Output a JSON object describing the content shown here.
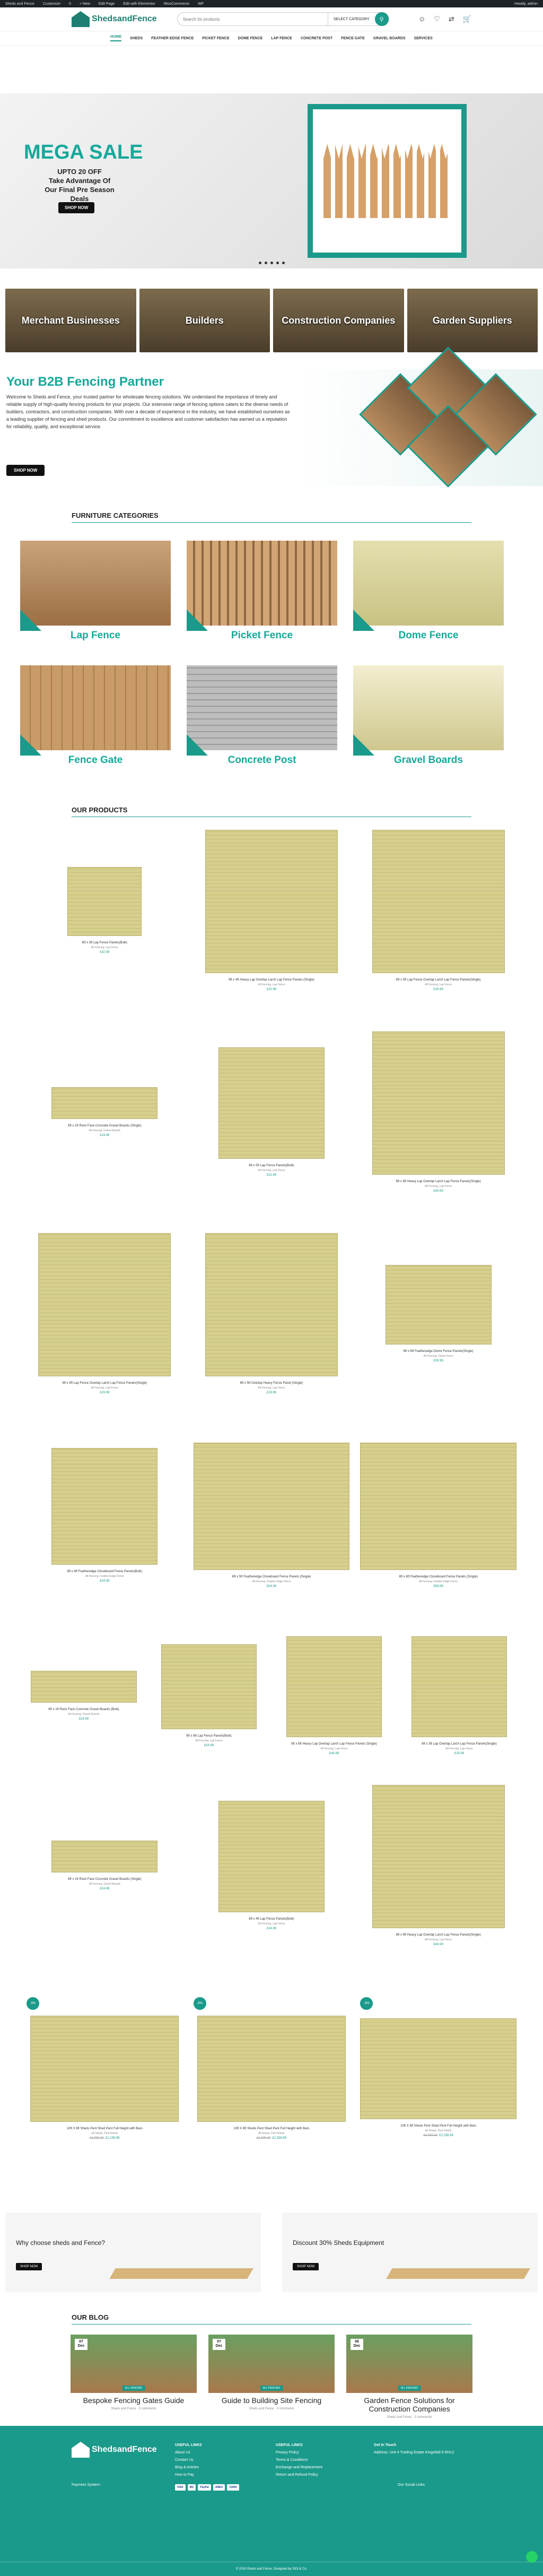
{
  "admin_bar": {
    "site": "Sheds and Fence",
    "customize": "Customize",
    "comments": "0",
    "new": "+ New",
    "edit_page": "Edit Page",
    "edit_with": "Edit with Elementor",
    "woo": "WooCommerce",
    "wp": "WP",
    "user": "Howdy, admin"
  },
  "header": {
    "logo_text": "ShedsandFence",
    "search_placeholder": "Search for products",
    "search_category": "SELECT CATEGORY"
  },
  "nav": [
    "HOME",
    "SHEDS",
    "FEATHER EDGE FENCE",
    "PICKET FENCE",
    "DOME FENCE",
    "LAP FENCE",
    "CONCRETE POST",
    "FENCE GATE",
    "GRAVEL BOARDS",
    "SERVICES"
  ],
  "hero": {
    "title": "MEGA SALE",
    "subtitle": "UPTO 20 OFF\nTake Advantage Of Our Final Pre Season Deals",
    "cta": "SHOP NOW"
  },
  "tiles": [
    "Merchant Businesses",
    "Builders",
    "Construction Companies",
    "Garden Suppliers"
  ],
  "b2b": {
    "title": "Your B2B Fencing Partner",
    "text": "Welcome to Sheds and Fence, your trusted partner for wholesale fencing solutions. We understand the importance of timely and reliable supply of high-quality fencing products for your projects. Our extensive range of fencing options caters to the diverse needs of builders, contractors, and construction companies. With over a decade of experience in the industry, we have established ourselves as a leading supplier of fencing and shed products. Our commitment to excellence and customer satisfaction has earned us a reputation for reliability, quality, and exceptional service.",
    "cta": "SHOP NOW"
  },
  "categories_title": "FURNITURE CATEGORIES",
  "categories": [
    "Lap Fence",
    "Picket Fence",
    "Dome Fence",
    "Fence Gate",
    "Concrete Post",
    "Gravel Boards"
  ],
  "products_title": "OUR PRODUCTS",
  "products": [
    {
      "name": "6ft x 3ft Lap Fence Panels(Bulk)",
      "cat": "All Fencing, Lap Fence",
      "price": "£32.99"
    },
    {
      "name": "6ft x 4ft Heavy Lap Overlap Larch Lap Fence Panels (Single)",
      "cat": "All Fencing, Lap Fence",
      "price": "£32.99"
    },
    {
      "name": "6ft x 5ft Lap Fence Overlap Larch Lap Fence Panels(Single)",
      "cat": "All Fencing, Lap Fence",
      "price": "£29.99"
    },
    {
      "name": "6ft x 1ft Rock Face Concrete Gravel Boards (Single)",
      "cat": "All Fencing, Gravel Boards",
      "price": "£24.99"
    },
    {
      "name": "6ft x 5ft Lap Fence Panels(Bulk)",
      "cat": "All Fencing, Lap Fence",
      "price": "£32.99"
    },
    {
      "name": "6ft x 6ft Heavy Lap Overlap Larch Lap Fence Panels(Single)",
      "cat": "All Fencing, Lap Fence",
      "price": "£44.99"
    },
    {
      "name": "6ft x 5ft Lap Fence Overlap Larch Lap Fence Panels(Single)",
      "cat": "All Fencing, Lap Fence",
      "price": "£29.99"
    },
    {
      "name": "6ft x 5ft Overlap Heavy Fence Panel (Single)",
      "cat": "All Fencing, Lap Fence",
      "price": "£29.99"
    },
    {
      "name": "6ft x 6ft Featheredge Dome Fence Panels(Single)",
      "cat": "All Fencing, Dome Fence",
      "price": "£39.99"
    },
    {
      "name": "6ft x 6ft Featheredge Closeboard Fence Panels(Bulk)",
      "cat": "All Fencing, Feather Edge Fence",
      "price": "£54.99"
    },
    {
      "name": "6ft x 5ft Featheredge Closeboard Fence Panels (Single)",
      "cat": "All Fencing, Feather Edge Fence",
      "price": "£54.99"
    },
    {
      "name": "6ft x 6ft Featheredge Closeboard Fence Panels (Single)",
      "cat": "All Fencing, Feather Edge Fence",
      "price": "£59.99"
    },
    {
      "name": "6ft x 1ft Rock Face Concrete Gravel Boards (Bulk)",
      "cat": "All Fencing, Gravel Boards",
      "price": "£24.99"
    },
    {
      "name": "6ft x 6ft Lap Fence Panels(Bulk)",
      "cat": "All Fencing, Lap Fence",
      "price": "£34.99"
    },
    {
      "name": "6ft x 6ft Heavy Lap Overlap Larch Lap Fence Panels (Single)",
      "cat": "All Fencing, Lap Fence",
      "price": "£44.99"
    },
    {
      "name": "6ft x 3ft Lap Overlap Larch Lap Fence Panels(Single)",
      "cat": "All Fencing, Lap Fence",
      "price": "£29.99"
    },
    {
      "name": "6ft x 1ft Rock Face Concrete Gravel Boards (Single)",
      "cat": "All Fencing, Gravel Boards",
      "price": "£24.99"
    },
    {
      "name": "6ft x 4ft Lap Fence Panels(Bulk)",
      "cat": "All Fencing, Lap Fence",
      "price": "£34.99"
    },
    {
      "name": "6ft x 6ft Heavy Lap Overlap Larch Lap Fence Panels(Single)",
      "cat": "All Fencing, Lap Fence",
      "price": "£44.99"
    },
    {
      "name": "10ft X 6ft Sheds Pent Shed Pent Full Height with Bars",
      "cat": "All Sheds, Pent Sheds",
      "old": "£2,999.99",
      "price": "£2,199.99",
      "badge": "-9%"
    },
    {
      "name": "10ft X 8ft Sheds Pent Shed Pent Full Height with Bars",
      "cat": "All Sheds, Pent Sheds",
      "old": "£2,999.99",
      "price": "£2,599.99",
      "badge": "-9%"
    },
    {
      "name": "10ft X 6ft Sheds Pent Shed Pent Full Height with Bars",
      "cat": "All Sheds, Pent Sheds",
      "old": "£2,999.99",
      "price": "£2,199.99",
      "badge": "-9%"
    }
  ],
  "promos": [
    {
      "title": "Why choose sheds and Fence?",
      "cta": "SHOP NOW"
    },
    {
      "title": "Discount 30% Sheds Equipment",
      "cta": "SHOP NOW"
    }
  ],
  "blog_title": "OUR BLOG",
  "blog": [
    {
      "day": "07",
      "month": "Dec",
      "title": "Bespoke Fencing Gates Guide",
      "tag": "ALL FENCING",
      "meta": "Sheds and Fence · 0 comments"
    },
    {
      "day": "07",
      "month": "Dec",
      "title": "Guide to Building Site Fencing",
      "tag": "ALL FENCING",
      "meta": "Sheds and Fence · 0 comments"
    },
    {
      "day": "06",
      "month": "Dec",
      "title": "Garden Fence Solutions for Construction Companies",
      "tag": "ALL FENCING",
      "meta": "Sheds and Fence · 0 comments"
    }
  ],
  "footer": {
    "col1_title": "USEFUL LINKS",
    "col1": [
      "About Us",
      "Contact Us",
      "Blog & Articles",
      "How to Pay"
    ],
    "col2_title": "USEFUL LINKS",
    "col2": [
      "Privacy Policy",
      "Terms & Conditions",
      "Exchange and Replacement",
      "Return and Refund Policy"
    ],
    "col3_title": "Get In Touch",
    "col3": "Address: Unit 4 Trading Estate Kingsfold 8 RH12",
    "payment": "Payment System :",
    "social": "Our Social Links",
    "copyright": "© 2024 Sheds and Fence. Designed by SIDI & Co."
  }
}
